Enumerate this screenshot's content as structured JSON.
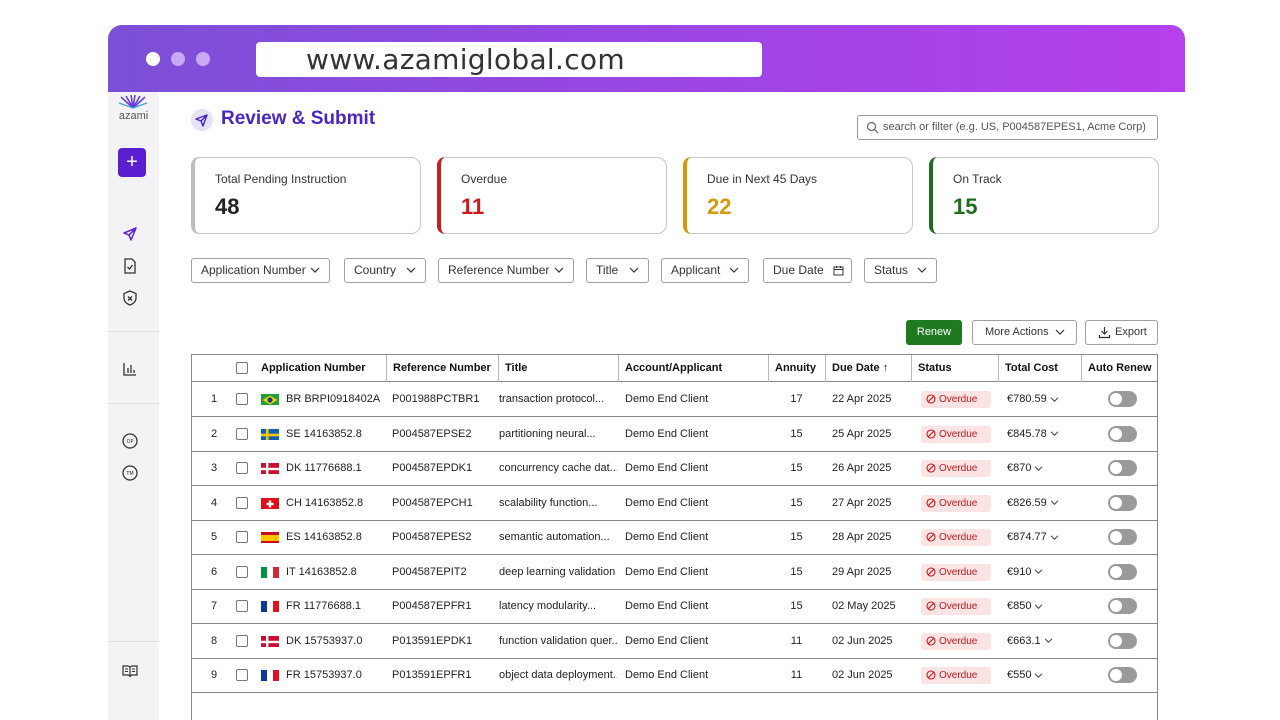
{
  "browser": {
    "url": "www.azamiglobal.com",
    "dot_colors": [
      "#ffffff",
      "#c9a9f3",
      "#c9a9f3"
    ]
  },
  "sidebar": {
    "logo_text": "azami",
    "add_label": "+"
  },
  "page": {
    "title": "Review & Submit"
  },
  "search": {
    "placeholder": "search or filter (e.g. US, P004587EPES1, Acme Corp)"
  },
  "summary": [
    {
      "label": "Total Pending Instruction",
      "value": "48",
      "color": "#222222",
      "accent": "#bdbdbd"
    },
    {
      "label": "Overdue",
      "value": "11",
      "color": "#c81e1e",
      "accent": "#c81e1e"
    },
    {
      "label": "Due in Next 45 Days",
      "value": "22",
      "color": "#d49a0a",
      "accent": "#d49a0a"
    },
    {
      "label": "On Track",
      "value": "15",
      "color": "#1e6e1e",
      "accent": "#1e6e1e"
    }
  ],
  "filters": [
    "Application Number",
    "Country",
    "Reference Number",
    "Title",
    "Applicant",
    "Due Date",
    "Status"
  ],
  "actions": {
    "renew": "Renew",
    "more": "More Actions",
    "export": "Export"
  },
  "table": {
    "headers": [
      "Application Number",
      "Reference Number",
      "Title",
      "Account/Applicant",
      "Annuity",
      "Due Date ↑",
      "Status",
      "Total Cost",
      "Auto Renew"
    ],
    "rows": [
      {
        "n": "1",
        "cc": "BR",
        "app": "BR BRPI0918402A",
        "ref": "P001988PCTBR1",
        "title": "transaction protocol...",
        "acct": "Demo End Client",
        "annuity": "17",
        "due": "22 Apr 2025",
        "status": "Overdue",
        "cost": "€780.59"
      },
      {
        "n": "2",
        "cc": "SE",
        "app": "SE 14163852.8",
        "ref": "P004587EPSE2",
        "title": "partitioning neural...",
        "acct": "Demo End Client",
        "annuity": "15",
        "due": "25 Apr 2025",
        "status": "Overdue",
        "cost": "€845.78"
      },
      {
        "n": "3",
        "cc": "DK",
        "app": "DK 11776688.1",
        "ref": "P004587EPDK1",
        "title": "concurrency cache dat...",
        "acct": "Demo End Client",
        "annuity": "15",
        "due": "26 Apr 2025",
        "status": "Overdue",
        "cost": "€870"
      },
      {
        "n": "4",
        "cc": "CH",
        "app": "CH 14163852.8",
        "ref": "P004587EPCH1",
        "title": "scalability function...",
        "acct": "Demo End Client",
        "annuity": "15",
        "due": "27 Apr 2025",
        "status": "Overdue",
        "cost": "€826.59"
      },
      {
        "n": "5",
        "cc": "ES",
        "app": "ES 14163852.8",
        "ref": "P004587EPES2",
        "title": "semantic automation...",
        "acct": "Demo End Client",
        "annuity": "15",
        "due": "28 Apr 2025",
        "status": "Overdue",
        "cost": "€874.77"
      },
      {
        "n": "6",
        "cc": "IT",
        "app": "IT 14163852.8",
        "ref": "P004587EPIT2",
        "title": "deep learning validation",
        "acct": "Demo End Client",
        "annuity": "15",
        "due": "29 Apr 2025",
        "status": "Overdue",
        "cost": "€910"
      },
      {
        "n": "7",
        "cc": "FR",
        "app": "FR 11776688.1",
        "ref": "P004587EPFR1",
        "title": "latency modularity...",
        "acct": "Demo End Client",
        "annuity": "15",
        "due": "02 May 2025",
        "status": "Overdue",
        "cost": "€850"
      },
      {
        "n": "8",
        "cc": "DK",
        "app": "DK 15753937.0",
        "ref": "P013591EPDK1",
        "title": "function validation quer...",
        "acct": "Demo End Client",
        "annuity": "11",
        "due": "02 Jun 2025",
        "status": "Overdue",
        "cost": "€663.1"
      },
      {
        "n": "9",
        "cc": "FR",
        "app": "FR 15753937.0",
        "ref": "P013591EPFR1",
        "title": "object data deployment...",
        "acct": "Demo End Client",
        "annuity": "11",
        "due": "02 Jun 2025",
        "status": "Overdue",
        "cost": "€550"
      }
    ]
  }
}
